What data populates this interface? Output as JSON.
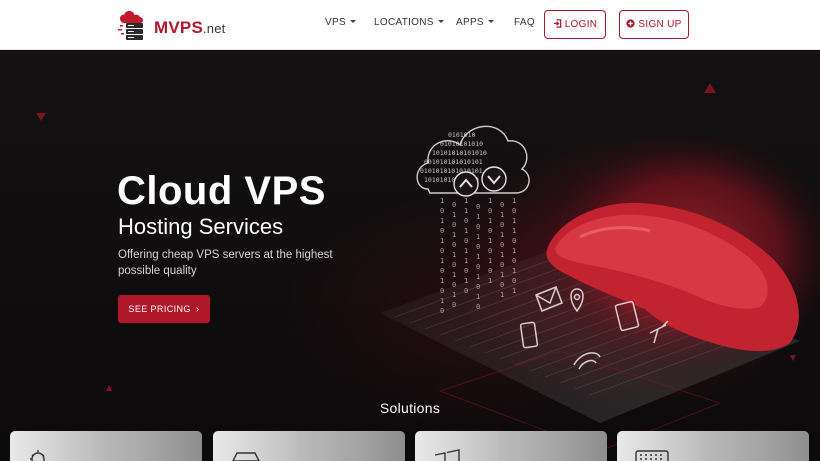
{
  "header": {
    "logo": {
      "brand": "MVPS",
      "tld": ".net"
    },
    "nav": [
      {
        "label": "VPS",
        "has_dropdown": true
      },
      {
        "label": "LOCATIONS",
        "has_dropdown": true
      },
      {
        "label": "APPS",
        "has_dropdown": true
      },
      {
        "label": "FAQ",
        "has_dropdown": false
      }
    ],
    "login": {
      "label": "LOGIN",
      "icon": "sign-in-icon"
    },
    "signup": {
      "label": "SIGN UP",
      "icon": "plus-circle-icon"
    }
  },
  "hero": {
    "title": "Cloud VPS",
    "subtitle": "Hosting Services",
    "description": "Offering cheap VPS servers at the highest possible quality",
    "cta": {
      "label": "SEE PRICING",
      "icon": "chevron-right-icon"
    },
    "cloud_binary_rows": [
      "0101010",
      "01010101010",
      "10101010101010",
      "001010101010101",
      "0101010101010101",
      "10101010101010"
    ]
  },
  "solutions": {
    "heading": "Solutions",
    "cards": [
      {
        "icon": "gear-cloud-icon"
      },
      {
        "icon": "server-icon"
      },
      {
        "icon": "windows-icon"
      },
      {
        "icon": "keyboard-icon"
      }
    ]
  },
  "colors": {
    "accent": "#b0182a",
    "hero_bg": "#0d0b0c",
    "header_bg": "#ffffff"
  }
}
